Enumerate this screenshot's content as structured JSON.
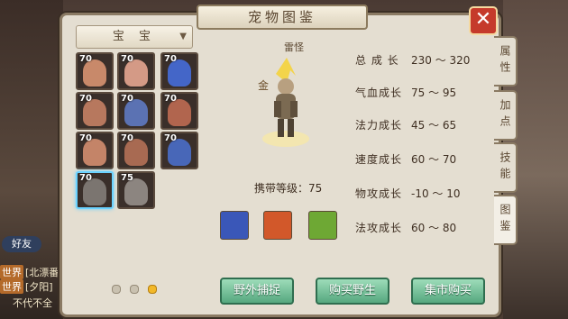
{
  "window": {
    "title": "宠物图鉴",
    "close_label": "✕"
  },
  "filter": {
    "selected": "宝 宝",
    "arrow": "▼"
  },
  "pets": [
    {
      "level": "70",
      "color": "#c8896a"
    },
    {
      "level": "70",
      "color": "#d49a86"
    },
    {
      "level": "70",
      "color": "#4466c8"
    },
    {
      "level": "70",
      "color": "#b7785e"
    },
    {
      "level": "70",
      "color": "#5b72b3"
    },
    {
      "level": "70",
      "color": "#b1654e"
    },
    {
      "level": "70",
      "color": "#c48468"
    },
    {
      "level": "70",
      "color": "#a86a52"
    },
    {
      "level": "70",
      "color": "#4867b8"
    },
    {
      "level": "70",
      "color": "#7b7570"
    },
    {
      "level": "75",
      "color": "#8c8580"
    }
  ],
  "pager": {
    "count": 3,
    "active": 2
  },
  "detail": {
    "name": "雷怪",
    "element": "金",
    "carry_level": "携带等级：75"
  },
  "stats": [
    {
      "label": "总 成 长",
      "value": "230 ～ 320"
    },
    {
      "label": "气血成长",
      "value": "75 ～ 95"
    },
    {
      "label": "法力成长",
      "value": "45 ～ 65"
    },
    {
      "label": "速度成长",
      "value": "60 ～ 70"
    },
    {
      "label": "物攻成长",
      "value": "-10 ～ 10"
    },
    {
      "label": "法攻成长",
      "value": "60 ～ 80"
    }
  ],
  "skills": [
    {
      "icon": "lightning-skill-icon",
      "color": "#3a57b8"
    },
    {
      "icon": "fire-skill-icon",
      "color": "#d2582a"
    },
    {
      "icon": "poison-skill-icon",
      "color": "#6ea834"
    }
  ],
  "buttons": {
    "wild": "野外捕捉",
    "buy": "购买野生",
    "market": "集市购买"
  },
  "tabs": [
    "属性",
    "加点",
    "技能",
    "图鉴"
  ],
  "chat": [
    {
      "tag": "世界",
      "text": "[北漂番"
    },
    {
      "tag": "世界",
      "text": "[夕阳]"
    },
    {
      "tag": "",
      "text": "不代不全"
    }
  ],
  "friend_label": "好友"
}
